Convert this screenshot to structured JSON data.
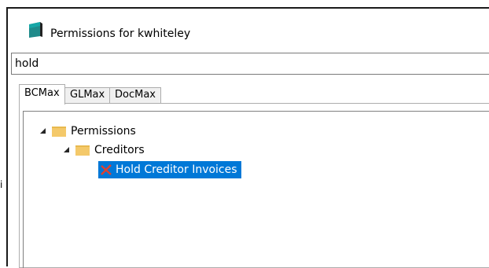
{
  "background": {
    "fragment": "i"
  },
  "window": {
    "title": "Permissions for kwhiteley",
    "icon": "database-icon"
  },
  "search": {
    "value": "hold"
  },
  "tabs": [
    {
      "label": "BCMax",
      "active": true
    },
    {
      "label": "GLMax",
      "active": false
    },
    {
      "label": "DocMax",
      "active": false
    }
  ],
  "tree": {
    "root": {
      "label": "Permissions",
      "expanded": true,
      "icon": "folder-icon"
    },
    "child": {
      "label": "Creditors",
      "expanded": true,
      "icon": "folder-icon"
    },
    "leaf": {
      "label": "Hold Creditor Invoices",
      "selected": true,
      "icon": "x-icon",
      "icon_color": "#e0412f"
    }
  },
  "colors": {
    "selection": "#0078d7",
    "folder": "#f4c96a"
  }
}
